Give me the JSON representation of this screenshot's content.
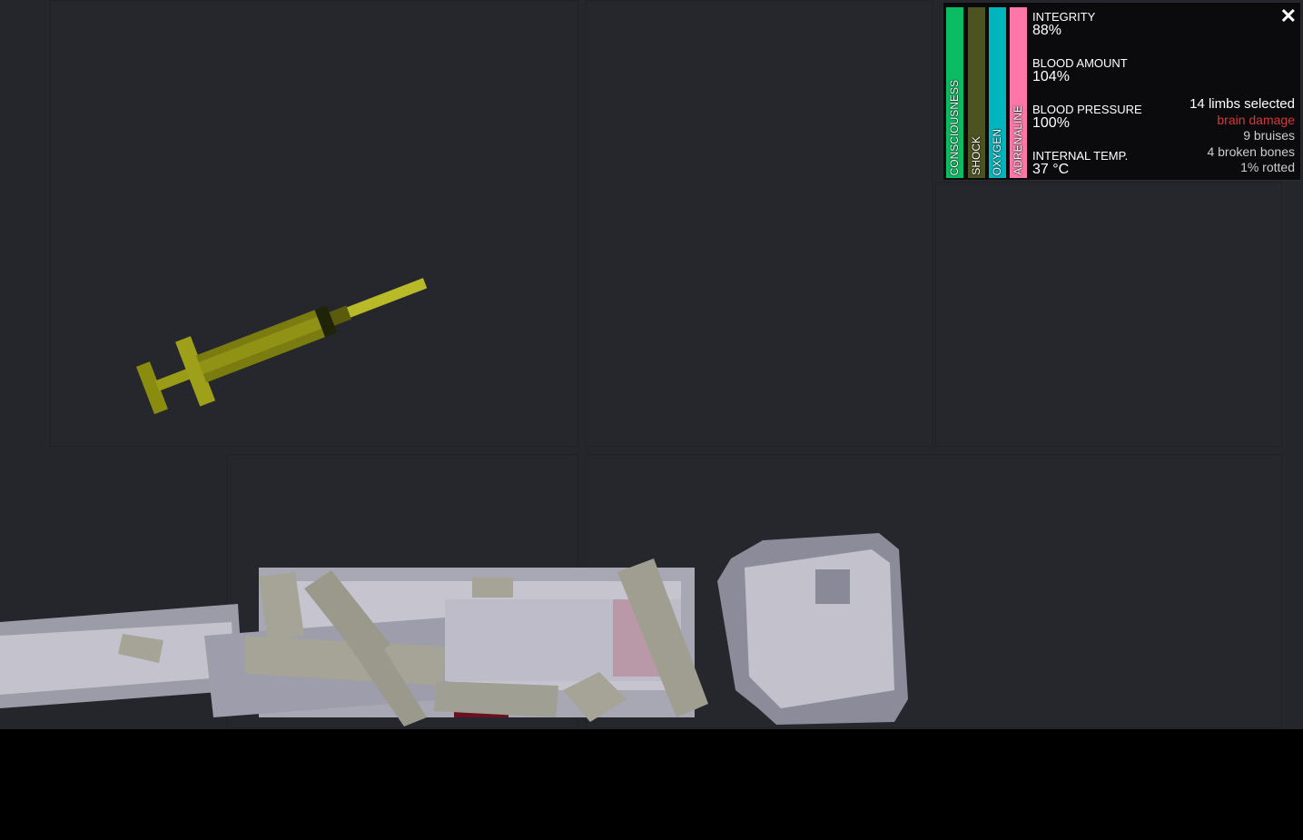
{
  "panel": {
    "bars": [
      {
        "label": "CONSCIOUSNESS",
        "color": "#0bbd62",
        "level": 1.0
      },
      {
        "label": "SHOCK",
        "color": "#4c5220",
        "level": 1.0
      },
      {
        "label": "OXYGEN",
        "color": "#00b5bd",
        "level": 1.0
      },
      {
        "label": "ADRENALINE",
        "color": "#ff77a8",
        "level": 1.0
      }
    ],
    "stats": [
      {
        "label": "INTEGRITY",
        "value": "88%"
      },
      {
        "label": "BLOOD AMOUNT",
        "value": "104%"
      },
      {
        "label": "BLOOD PRESSURE",
        "value": "100%"
      },
      {
        "label": "INTERNAL TEMP.",
        "value": "37 °C"
      }
    ],
    "info": {
      "limbs": "14 limbs selected",
      "brain": "brain damage",
      "bruises": "9 bruises",
      "bones": "4 broken bones",
      "rotted": "1% rotted"
    },
    "close_icon": "close-icon"
  }
}
